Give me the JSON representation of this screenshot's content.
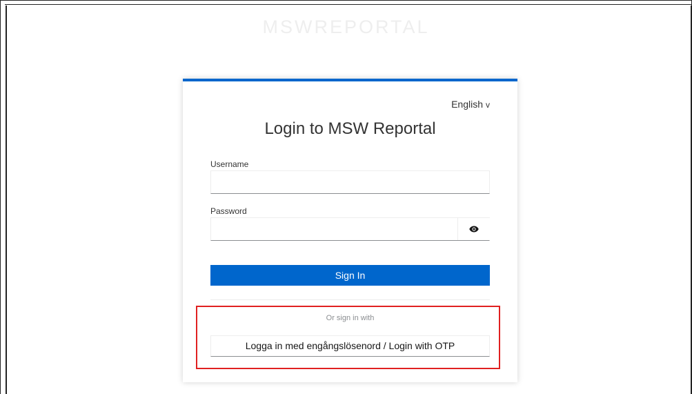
{
  "brand": {
    "name": "MSWREPORTAL"
  },
  "login": {
    "language": "English",
    "language_chevron": "v",
    "title": "Login to MSW Reportal",
    "username_label": "Username",
    "username_value": "",
    "password_label": "Password",
    "password_value": "",
    "password_toggle_icon": "eye-icon",
    "sign_in_label": "Sign In",
    "or_sign_in_with": "Or sign in with",
    "otp_label": "Logga in med engångslösenord / Login with OTP"
  },
  "colors": {
    "accent": "#0066cc",
    "highlight": "#e02020"
  }
}
